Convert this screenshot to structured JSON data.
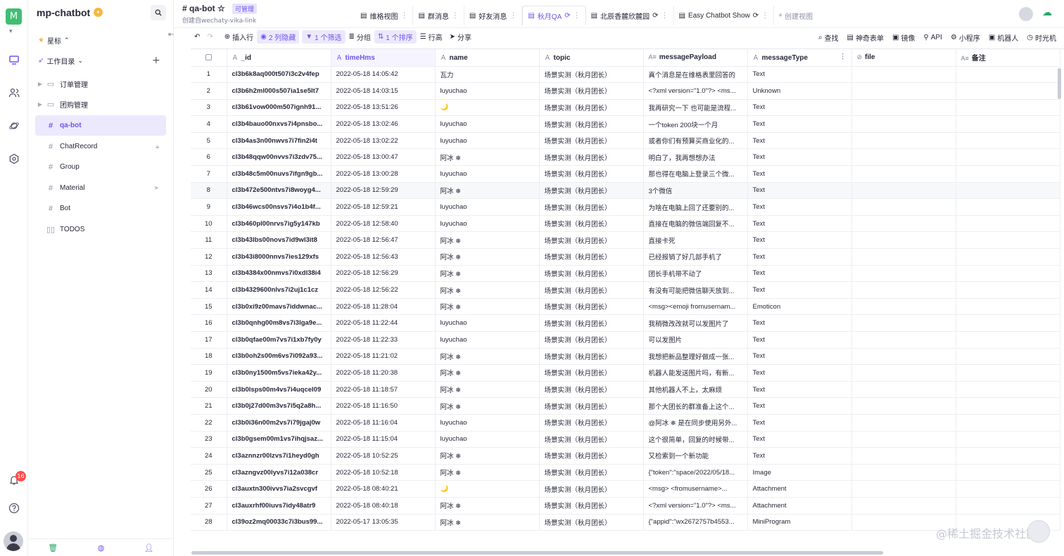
{
  "space": {
    "name": "mp-chatbot",
    "avatar_letter": "M",
    "badge_icon": "●",
    "notifications": "16"
  },
  "sidebar": {
    "starred_label": "星标",
    "catalog_label": "工作目录",
    "nodes": [
      {
        "label": "订单管理",
        "icon": "folder-icon",
        "folder": true
      },
      {
        "label": "团购管理",
        "icon": "folder-icon",
        "folder": true
      },
      {
        "label": "qa-bot",
        "icon": "sheet-icon",
        "active": true
      },
      {
        "label": "ChatRecord",
        "icon": "sheet-icon",
        "trail": "lock-icon"
      },
      {
        "label": "Group",
        "icon": "sheet-icon"
      },
      {
        "label": "Material",
        "icon": "sheet-icon",
        "trail": "share-icon"
      },
      {
        "label": "Bot",
        "icon": "sheet-icon"
      },
      {
        "label": "TODOS",
        "icon": "kanban-icon"
      }
    ]
  },
  "header": {
    "title": "qa-bot",
    "permission": "可管理",
    "subtitle": "创建自wechaty-vika-link",
    "views": [
      {
        "label": "维格视图",
        "icon": "grid-icon"
      },
      {
        "label": "群消息",
        "icon": "grid-icon"
      },
      {
        "label": "好友消息",
        "icon": "grid-icon"
      },
      {
        "label": "秋月QA",
        "icon": "grid-icon",
        "active": true
      },
      {
        "label": "北辰香麓欣麓园",
        "icon": "grid-icon"
      },
      {
        "label": "Easy Chatbot Show",
        "icon": "grid-icon"
      }
    ],
    "create_view": "创建视图"
  },
  "toolbar": {
    "insert_row": "插入行",
    "hidden": "2 列隐藏",
    "filter": "1 个筛选",
    "group": "分组",
    "sort": "1 个排序",
    "row_height": "行高",
    "share": "分享",
    "right": [
      "查找",
      "神奇表单",
      "镜像",
      "API",
      "小程序",
      "机器人",
      "时光机"
    ]
  },
  "columns": [
    "_id",
    "timeHms",
    "name",
    "topic",
    "messagePayload",
    "messageType",
    "file",
    "备注"
  ],
  "rows": [
    [
      "1",
      "cl3b6k8aq000t507i3c2v4fep",
      "2022-05-18 14:05:42",
      "瓦力",
      "场景实测（秋月团长）",
      "真个消息是在维格表里回答的",
      "Text"
    ],
    [
      "2",
      "cl3b6h2ml000s507ia1se5lt7",
      "2022-05-18 14:03:15",
      "luyuchao",
      "场景实测（秋月团长）",
      "<?xml version=\"1.0\"?> <ms...",
      "Unknown"
    ],
    [
      "3",
      "cl3b61vow000m507ignh91...",
      "2022-05-18 13:51:26",
      "🌙",
      "场景实测（秋月团长）",
      "我再研究一下 也可能是流程...",
      "Text"
    ],
    [
      "4",
      "cl3b4bauo00nxvs7i4pnsbo...",
      "2022-05-18 13:02:46",
      "luyuchao",
      "场景实测（秋月团长）",
      "一个token 200块一个月",
      "Text"
    ],
    [
      "5",
      "cl3b4as3n00nwvs7i7fin2i4t",
      "2022-05-18 13:02:22",
      "luyuchao",
      "场景实测（秋月团长）",
      "或者你们有预算买商业化的...",
      "Text"
    ],
    [
      "6",
      "cl3b48qqw00nvvs7i3zdv75...",
      "2022-05-18 13:00:47",
      "阿冰 ❄",
      "场景实测（秋月团长）",
      "明白了，我再想想办法",
      "Text"
    ],
    [
      "7",
      "cl3b48c5m00nuvs7ifgn9gb...",
      "2022-05-18 13:00:28",
      "luyuchao",
      "场景实测（秋月团长）",
      "那也得在电脑上登录三个微...",
      "Text"
    ],
    [
      "8",
      "cl3b472e500ntvs7i8woyg4...",
      "2022-05-18 12:59:29",
      "阿冰 ❄",
      "场景实测（秋月团长）",
      "3个微信",
      "Text"
    ],
    [
      "9",
      "cl3b46wcs00nsvs7i4o1b4f...",
      "2022-05-18 12:59:21",
      "luyuchao",
      "场景实测（秋月团长）",
      "为啥在电脑上回了还要别的...",
      "Text"
    ],
    [
      "10",
      "cl3b460pl00nrvs7ig5y147kb",
      "2022-05-18 12:58:40",
      "luyuchao",
      "场景实测（秋月团长）",
      "直接在电脑的微信端回复不...",
      "Text"
    ],
    [
      "11",
      "cl3b43lbs00novs7id9wl3it8",
      "2022-05-18 12:56:47",
      "阿冰 ❄",
      "场景实测（秋月团长）",
      "直接卡死",
      "Text"
    ],
    [
      "12",
      "cl3b43i8000nnvs7ies129xfs",
      "2022-05-18 12:56:43",
      "阿冰 ❄",
      "场景实测（秋月团长）",
      "已经报销了好几部手机了",
      "Text"
    ],
    [
      "13",
      "cl3b4384x00nmvs7i0xdl38i4",
      "2022-05-18 12:56:29",
      "阿冰 ❄",
      "场景实测（秋月团长）",
      "团长手机带不动了",
      "Text"
    ],
    [
      "14",
      "cl3b4329600nlvs7i2uj1c1cz",
      "2022-05-18 12:56:22",
      "阿冰 ❄",
      "场景实测（秋月团长）",
      "有没有可能把微信聊天放到...",
      "Text"
    ],
    [
      "15",
      "cl3b0xi9z00mavs7iddwnac...",
      "2022-05-18 11:28:04",
      "阿冰 ❄",
      "场景实测（秋月团长）",
      "<msg><emoji fromusernam...",
      "Emoticon"
    ],
    [
      "16",
      "cl3b0qnhg00m8vs7i3lga9e...",
      "2022-05-18 11:22:44",
      "luyuchao",
      "场景实测（秋月团长）",
      "我稍微改改就可以发图片了",
      "Text"
    ],
    [
      "17",
      "cl3b0qfae00m7vs7i1xb7fy0y",
      "2022-05-18 11:22:33",
      "luyuchao",
      "场景实测（秋月团长）",
      "可以发图片",
      "Text"
    ],
    [
      "18",
      "cl3b0oh2s00m6vs7i092a93...",
      "2022-05-18 11:21:02",
      "阿冰 ❄",
      "场景实测（秋月团长）",
      "我想把新品整理好做成一张...",
      "Text"
    ],
    [
      "19",
      "cl3b0ny1500m5vs7ieka42y...",
      "2022-05-18 11:20:38",
      "阿冰 ❄",
      "场景实测（秋月团长）",
      "机器人能发送图片吗，有新...",
      "Text"
    ],
    [
      "20",
      "cl3b0lsps00m4vs7i4uqcel09",
      "2022-05-18 11:18:57",
      "阿冰 ❄",
      "场景实测（秋月团长）",
      "其他机器人不上，太麻烦",
      "Text"
    ],
    [
      "21",
      "cl3b0j27d00m3vs7i5q2a8h...",
      "2022-05-18 11:16:50",
      "阿冰 ❄",
      "场景实测（秋月团长）",
      "那个大团长的群准备上这个...",
      "Text"
    ],
    [
      "22",
      "cl3b0i36n00m2vs7i79jgaj0w",
      "2022-05-18 11:16:04",
      "luyuchao",
      "场景实测（秋月团长）",
      "@阿冰 ❄ 是在同步使用另外...",
      "Text"
    ],
    [
      "23",
      "cl3b0gsem00m1vs7ihqjsaz...",
      "2022-05-18 11:15:04",
      "luyuchao",
      "场景实测（秋月团长）",
      "这个很简单，回复的时候带...",
      "Text"
    ],
    [
      "24",
      "cl3aznnzr00lzvs7i1heyd0gh",
      "2022-05-18 10:52:25",
      "阿冰 ❄",
      "场景实测（秋月团长）",
      "又检索到一个新功能",
      "Text"
    ],
    [
      "25",
      "cl3azngvz00lyvs7i12a038cr",
      "2022-05-18 10:52:18",
      "阿冰 ❄",
      "场景实测（秋月团长）",
      "{\"token\":\"space/2022/05/18...",
      "Image"
    ],
    [
      "26",
      "cl3auxtn300ivvs7ia2svcgvf",
      "2022-05-18 08:40:21",
      "🌙",
      "场景实测（秋月团长）",
      "<msg>    <fromusername>...",
      "Attachment"
    ],
    [
      "27",
      "cl3auxrhf00iuvs7idy48atr9",
      "2022-05-18 08:40:18",
      "阿冰 ❄",
      "场景实测（秋月团长）",
      "<?xml version=\"1.0\"?> <ms...",
      "Attachment"
    ],
    [
      "28",
      "cl39oz2mq00033c7i3bus99...",
      "2022-05-17 13:05:35",
      "阿冰 ❄",
      "场景实测（秋月团长）",
      "{\"appid\":\"wx2672757b4553...",
      "MiniProgram"
    ]
  ],
  "watermark": "@稀土掘金技术社区"
}
